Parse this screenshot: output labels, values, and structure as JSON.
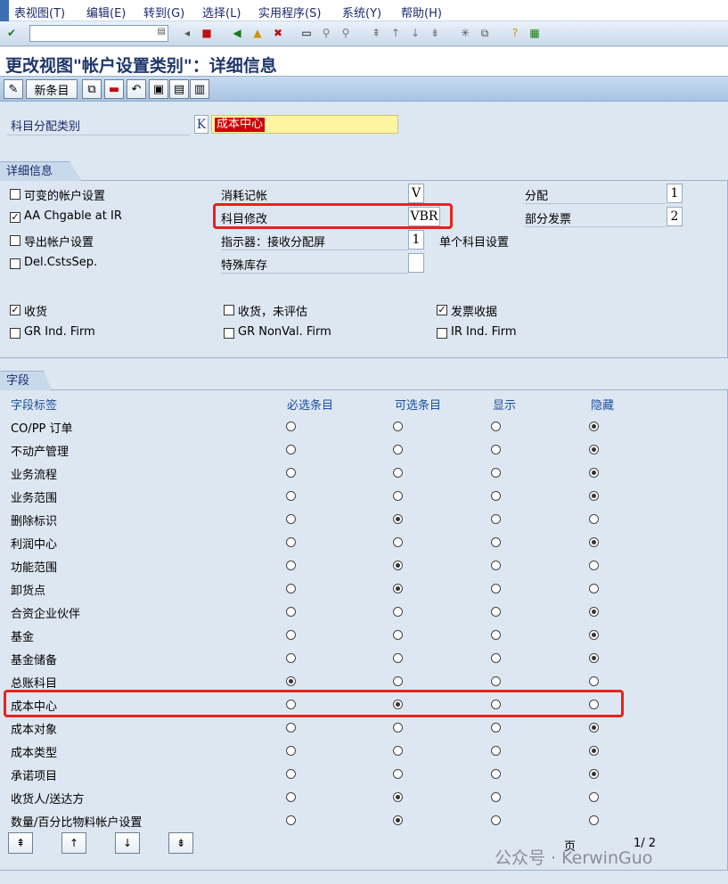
{
  "menubar": {
    "items": [
      "表视图(T)",
      "编辑(E)",
      "转到(G)",
      "选择(L)",
      "实用程序(S)",
      "系统(Y)",
      "帮助(H)"
    ]
  },
  "toolbar": {
    "command_value": "",
    "icons": [
      "check-icon",
      "save-icon",
      "back-icon",
      "exit-icon",
      "cancel-icon",
      "print-icon",
      "find-icon",
      "find-next-icon",
      "first-page-icon",
      "prev-page-icon",
      "next-page-icon",
      "last-page-icon",
      "new-session-icon",
      "shortcut-icon",
      "help-icon",
      "layout-icon"
    ]
  },
  "page_title": "更改视图\"帐户设置类别\"：详细信息",
  "app_toolbar": {
    "new_entries_label": "新条目"
  },
  "header": {
    "category_label": "科目分配类别",
    "category_code": "K",
    "category_name": "成本中心"
  },
  "details": {
    "tab_label": "详细信息",
    "checkboxes": [
      {
        "label": "可变的帐户设置",
        "checked": false
      },
      {
        "label": "AA Chgable at IR",
        "checked": true
      },
      {
        "label": "导出帐户设置",
        "checked": false
      },
      {
        "label": "Del.CstsSep.",
        "checked": false
      }
    ],
    "fields": [
      {
        "label": "消耗记帐",
        "value": "V"
      },
      {
        "label": "科目修改",
        "value": "VBR"
      },
      {
        "label": "指示器：接收分配屏",
        "value": "1"
      },
      {
        "label": "特殊库存",
        "value": ""
      }
    ],
    "single_account_label": "单个科目设置",
    "right_fields": [
      {
        "label": "分配",
        "value": "1"
      },
      {
        "label": "部分发票",
        "value": "2"
      }
    ],
    "row2": [
      {
        "label": "收货",
        "checked": true
      },
      {
        "label": "收货，未评估",
        "checked": false
      },
      {
        "label": "发票收据",
        "checked": true
      },
      {
        "label": "GR Ind. Firm",
        "checked": false
      },
      {
        "label": "GR NonVal. Firm",
        "checked": false
      },
      {
        "label": "IR Ind. Firm",
        "checked": false
      }
    ]
  },
  "fields_group": {
    "tab_label": "字段",
    "columns": [
      "字段标签",
      "必选条目",
      "可选条目",
      "显示",
      "隐藏"
    ],
    "rows": [
      {
        "label": "CO/PP 订单",
        "sel": 3
      },
      {
        "label": "不动产管理",
        "sel": 3
      },
      {
        "label": "业务流程",
        "sel": 3
      },
      {
        "label": "业务范围",
        "sel": 3
      },
      {
        "label": "删除标识",
        "sel": 1
      },
      {
        "label": "利润中心",
        "sel": 3
      },
      {
        "label": "功能范围",
        "sel": 1
      },
      {
        "label": "卸货点",
        "sel": 1
      },
      {
        "label": "合资企业伙伴",
        "sel": 3
      },
      {
        "label": "基金",
        "sel": 3
      },
      {
        "label": "基金储备",
        "sel": 3
      },
      {
        "label": "总账科目",
        "sel": 0
      },
      {
        "label": "成本中心",
        "sel": 1
      },
      {
        "label": "成本对象",
        "sel": 3
      },
      {
        "label": "成本类型",
        "sel": 3
      },
      {
        "label": "承诺项目",
        "sel": 3
      },
      {
        "label": "收货人/送达方",
        "sel": 1
      },
      {
        "label": "数量/百分比物料帐户设置",
        "sel": 1
      }
    ],
    "page_label": "页",
    "page_value": "1/ 2"
  },
  "watermark": "公众号 · KerwinGuo",
  "colors": {
    "highlight": "#e8221c",
    "title": "#20376b"
  }
}
